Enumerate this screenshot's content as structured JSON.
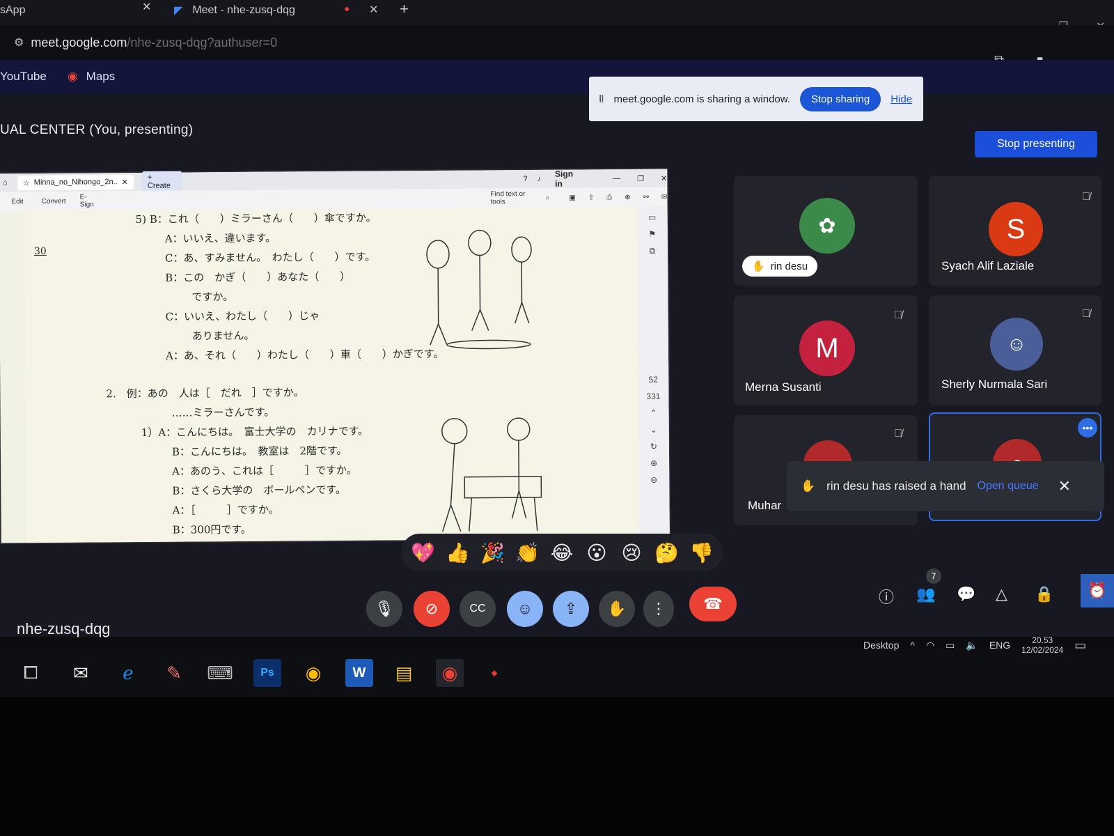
{
  "browser": {
    "tab_prev_title": "sApp",
    "tab_title": "Meet - nhe-zusq-dqg",
    "url_domain": "meet.google.com",
    "url_path": "/nhe-zusq-dqg?authuser=0",
    "bookmarks": [
      "YouTube",
      "Maps"
    ]
  },
  "share_banner": {
    "message": "meet.google.com is sharing a window.",
    "stop_label": "Stop sharing",
    "hide_label": "Hide"
  },
  "meet": {
    "presenting_title": "UAL CENTER (You, presenting)",
    "stop_presenting_label": "Stop presenting",
    "meeting_code": "nhe-zusq-dqg",
    "participant_count": "7"
  },
  "shared_window": {
    "tab_label": "Minna_no_Nihongo_2n..",
    "create_label": "Create",
    "signin_label": "Sign in",
    "menu": [
      "Edit",
      "Convert",
      "E-Sign"
    ],
    "find_label": "Find text or tools",
    "page_num": "30",
    "side_nums": [
      "52",
      "331"
    ],
    "lines": [
      "5) B：これ（　　）ミラーさん（　　）傘ですか。",
      "A：いいえ、違います。",
      "C：あ、すみません。　わたし（　　）です。",
      "B：この　かぎ（　　）あなた（　　）",
      "ですか。",
      "C：いいえ、わたし（　　）じゃ",
      "ありません。",
      "A：あ、それ（　　）わたし（　　）車（　　）かぎです。",
      "2.　例：あの　人は［　だれ　］ですか。",
      "……ミラーさんです。",
      "1）A：こんにちは。　富士大学の　カリナです。",
      "B：こんにちは。　教室は　2階です。",
      "A：あのう、これは［　　　］ですか。",
      "B：さくら大学の　ボールペンです。",
      "A：［　　　］ですか。",
      "B：300円です。"
    ]
  },
  "participants": [
    {
      "name": "rin desu",
      "type": "photo",
      "color": "#3b8a4a"
    },
    {
      "name": "Syach Alif Laziale",
      "initial": "S",
      "color": "#d93a14"
    },
    {
      "name": "Merna Susanti",
      "initial": "M",
      "color": "#c4213f"
    },
    {
      "name": "Sherly Nurmala Sari",
      "type": "photo",
      "color": "#4a5f9a"
    },
    {
      "name": "Muhar",
      "type": "photo",
      "color": "#b02a2a"
    }
  ],
  "toast": {
    "message": "rin desu has raised a hand",
    "action": "Open queue"
  },
  "reactions": [
    "💖",
    "👍",
    "🎉",
    "👏",
    "😂",
    "😮",
    "😢",
    "🤔",
    "👎"
  ],
  "taskbar": {
    "tray_desktop": "Desktop",
    "lang": "ENG",
    "time": "20.53",
    "date": "12/02/2024"
  }
}
